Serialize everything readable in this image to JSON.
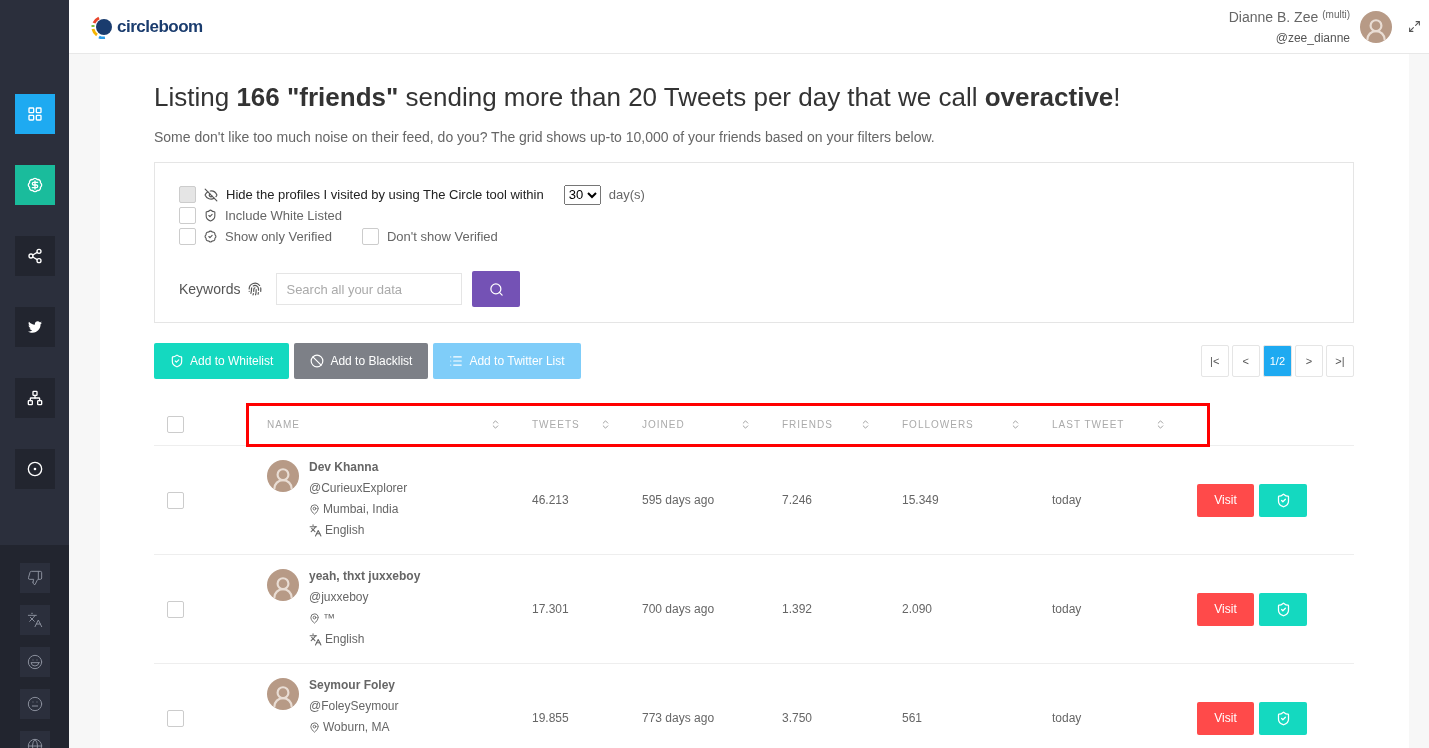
{
  "sidebar": {
    "items": [
      {
        "color": "#1eaaf1"
      },
      {
        "color": "#1abc9c"
      },
      {
        "color": "#22252f"
      },
      {
        "color": "#22252f"
      },
      {
        "color": "#22252f"
      },
      {
        "color": "#22252f"
      }
    ]
  },
  "header": {
    "logo": "circleboom",
    "user_name": "Dianne B. Zee",
    "user_badge": "(multi)",
    "handle": "@zee_dianne"
  },
  "title": "Listing **166 \"friends\"** sending more than 20 Tweets per day that we call **overactive**!",
  "subtitle": "Some don't like too much noise on their feed, do you? The grid shows up-to 10,000 of your friends based on your filters below.",
  "filters": {
    "hide_visited": {
      "label": "Hide the profiles I visited by using The Circle tool within",
      "checked": false,
      "days": "30",
      "unit": "day(s)"
    },
    "include_whitelisted": {
      "label": "Include White Listed",
      "checked": false
    },
    "show_only_verified": {
      "label": "Show only Verified",
      "checked": false
    },
    "dont_show_verified": {
      "label": "Don't show Verified",
      "checked": false
    },
    "keywords": {
      "label": "Keywords",
      "placeholder": "Search all your data"
    }
  },
  "actions": [
    {
      "kind": "whitelist",
      "label": "Add to Whitelist"
    },
    {
      "kind": "blacklist",
      "label": "Add to Blacklist"
    },
    {
      "kind": "list",
      "label": "Add to Twitter List"
    }
  ],
  "pagination": [
    {
      "label": "|<",
      "selected": false
    },
    {
      "label": "<",
      "selected": false
    },
    {
      "label": "1/2",
      "selected": true
    },
    {
      "label": ">",
      "selected": false
    },
    {
      "label": ">|",
      "selected": false
    }
  ],
  "table": {
    "select_all": false,
    "columns": [
      "NAME",
      "TWEETS",
      "JOINED",
      "FRIENDS",
      "FOLLOWERS",
      "LAST TWEET"
    ],
    "rows": [
      {
        "checked": false,
        "name": "Dev Khanna",
        "handle": "@CurieuxExplorer",
        "location": "Mumbai, India",
        "language": "English",
        "tweets": "46.213",
        "joined": "595 days ago",
        "friends": "7.246",
        "followers": "15.349",
        "last_tweet": "today",
        "visit": "Visit"
      },
      {
        "checked": false,
        "name": "yeah, thxt juxxeboy",
        "handle": "@juxxeboy",
        "location": "™",
        "language": "English",
        "tweets": "17.301",
        "joined": "700 days ago",
        "friends": "1.392",
        "followers": "2.090",
        "last_tweet": "today",
        "visit": "Visit"
      },
      {
        "checked": false,
        "name": "Seymour Foley",
        "handle": "@FoleySeymour",
        "location": "Woburn, MA",
        "tweets": "19.855",
        "joined": "773 days ago",
        "friends": "3.750",
        "followers": "561",
        "last_tweet": "today",
        "visit": "Visit"
      }
    ]
  }
}
